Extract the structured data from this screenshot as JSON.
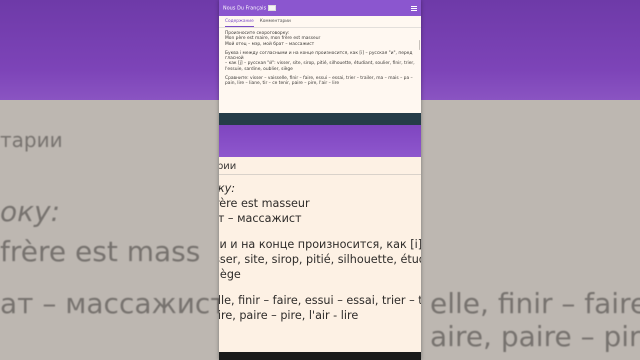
{
  "app": {
    "title": "Nous Du Français",
    "tabs": [
      "Содержание",
      "Комментарии"
    ]
  },
  "content": {
    "p1": [
      "Произносите скороговорку:",
      "Mon père est maire, mon frère est masseur",
      "Мой отец – мэр, мой брат – массажист"
    ],
    "p2": [
      "Буква i между согласными и на конце произносится, как [i] – русская \"и\", перед гласной",
      "– как [j] – русская \"й\": visser, site, sirop, pitié, silhouette, étudiant, soulier, finir, trier,",
      "l'essuie, sardine, oublier, siège"
    ],
    "p3": [
      "Сравните: visser – vaisselle, finir – faire, essui – essai, trier – trailer, ma – mais – pa –",
      "pain, lire – liane, tir – ce tenir, paire – pire, l'air – lire"
    ]
  },
  "zoomed": {
    "tab": "тарии",
    "lines": [
      "оку:",
      "frère est masseur",
      "ат – массажист",
      "ми и на конце произносится, как [i] - рус",
      "isser, site, sirop, pitié, silhouette, étudiant,",
      " siège",
      "elle, finir – faire, essui – essai, trier – traite",
      "aire, paire – pire, l'air - lire"
    ]
  },
  "background": {
    "lines": [
      "тарии",
      "оку:",
      " frère est mass",
      "ат – массажист",
      "elle, finir – faire",
      "aire, paire – pire"
    ]
  },
  "colors": {
    "accent": "#8b56cf",
    "page": "#fdf1e4"
  }
}
